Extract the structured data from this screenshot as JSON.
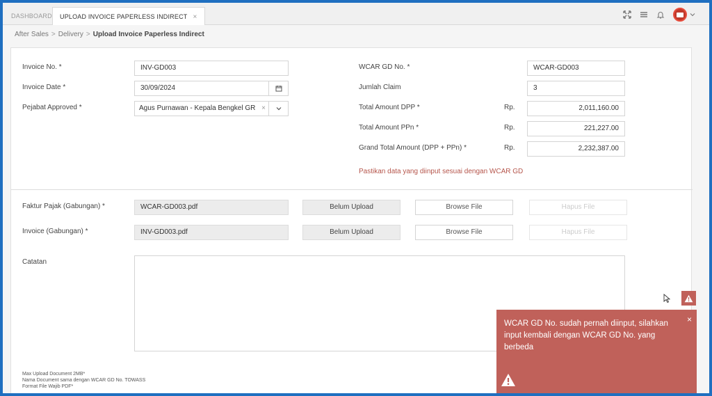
{
  "tabs": [
    {
      "label": "DASHBOARD"
    },
    {
      "label": "UPLOAD INVOICE PAPERLESS INDIRECT",
      "close": "×"
    }
  ],
  "breadcrumb": {
    "item1": "After Sales",
    "item2": "Delivery",
    "current": "Upload Invoice Paperless Indirect",
    "separator": ">"
  },
  "form": {
    "invoice_no": {
      "label": "Invoice No. *",
      "value": "INV-GD003"
    },
    "invoice_date": {
      "label": "Invoice Date *",
      "value": "30/09/2024"
    },
    "pejabat": {
      "label": "Pejabat Approved *",
      "value": "Agus Purnawan - Kepala Bengkel GR",
      "clear": "×"
    },
    "wcar_gd_no": {
      "label": "WCAR GD No. *",
      "value": "WCAR-GD003"
    },
    "jumlah_claim": {
      "label": "Jumlah Claim",
      "value": "3"
    },
    "total_dpp": {
      "label": "Total Amount DPP *",
      "currency": "Rp.",
      "value": "2,011,160.00"
    },
    "total_ppn": {
      "label": "Total Amount PPn *",
      "currency": "Rp.",
      "value": "221,227.00"
    },
    "grand_total": {
      "label": "Grand Total Amount (DPP + PPn) *",
      "currency": "Rp.",
      "value": "2,232,387.00"
    },
    "warning": "Pastikan data yang diinput sesuai dengan WCAR GD"
  },
  "uploads": {
    "faktur": {
      "label": "Faktur Pajak (Gabungan) *",
      "file": "WCAR-GD003.pdf",
      "status": "Belum Upload",
      "browse": "Browse File",
      "delete": "Hapus File"
    },
    "invoice": {
      "label": "Invoice (Gabungan) *",
      "file": "INV-GD003.pdf",
      "status": "Belum Upload",
      "browse": "Browse File",
      "delete": "Hapus File"
    },
    "catatan": {
      "label": "Catatan",
      "value": ""
    }
  },
  "notes": {
    "line1": "Max Upload Document 2MB*",
    "line2": "Nama Document sama dengan WCAR GD No. TOWASS",
    "line3": "Format File Wajib PDF*"
  },
  "toast": {
    "message": "WCAR GD No. sudah pernah diinput, silahkan input kembali dengan WCAR GD No. yang berbeda",
    "close": "×",
    "color": "#c0615a"
  }
}
